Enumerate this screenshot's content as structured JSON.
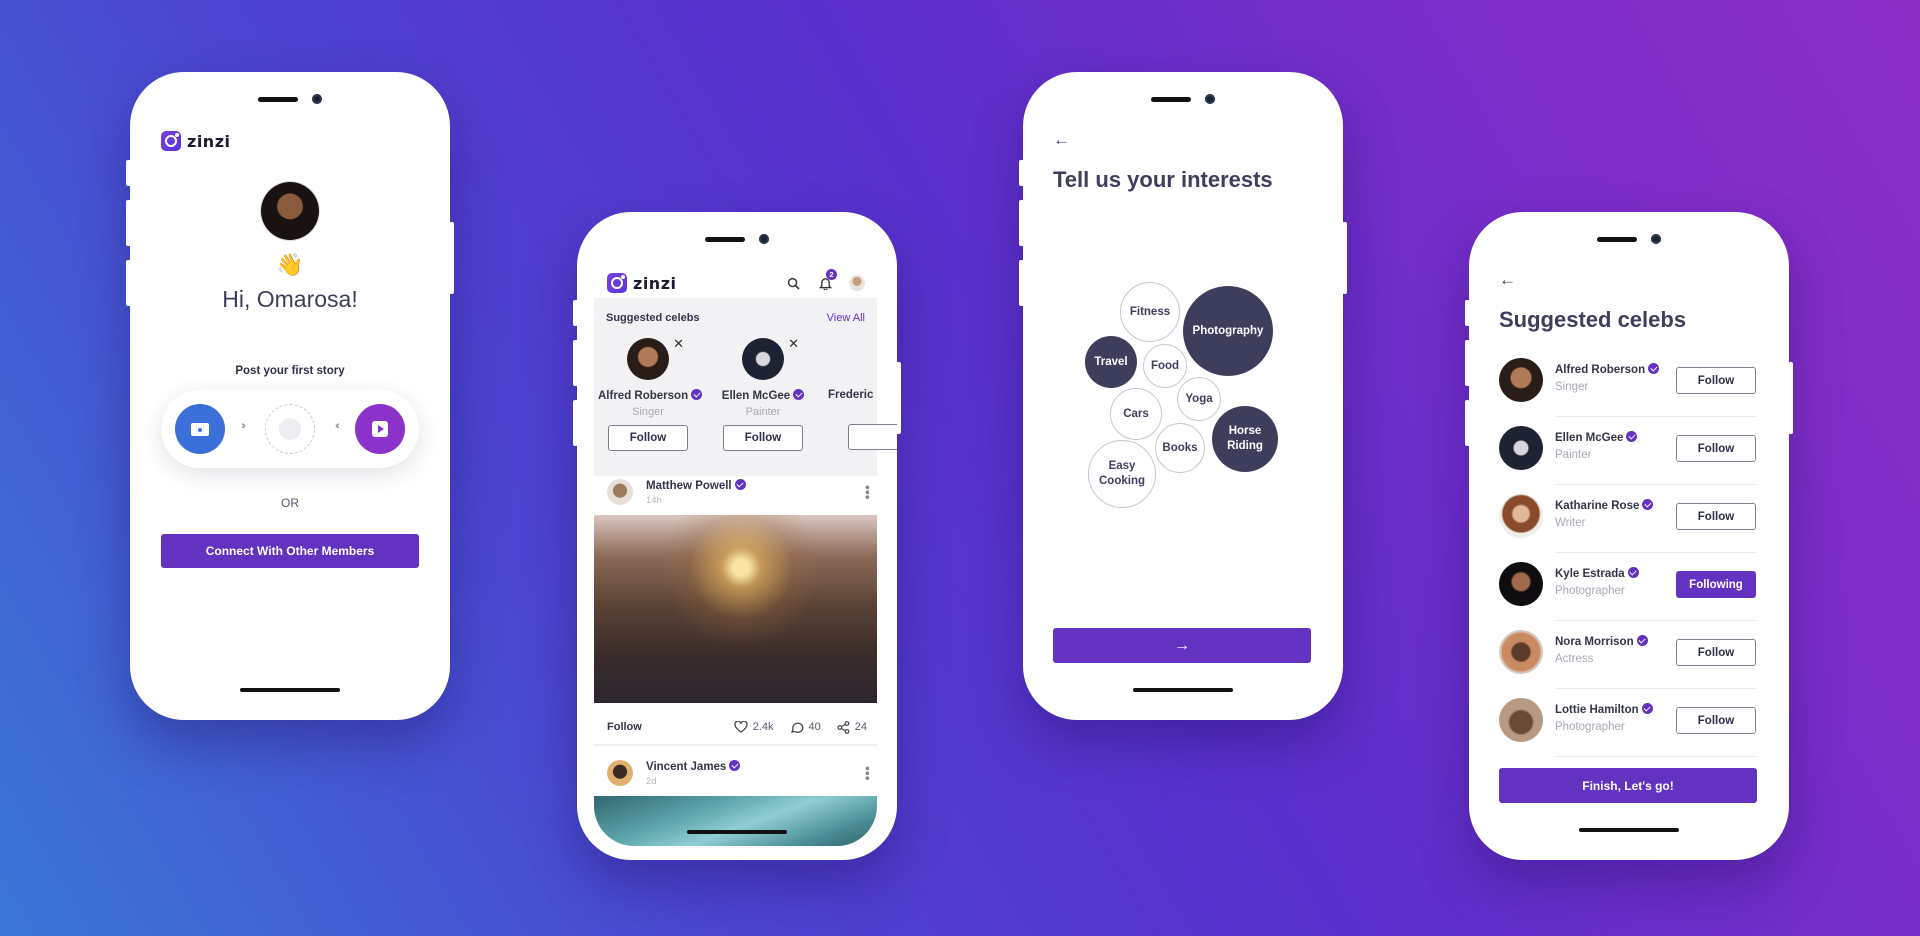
{
  "brand": {
    "name": "zinzi",
    "accent": "#6332c1"
  },
  "background": {
    "gradient": [
      "#3a77d6",
      "#5a30cc",
      "#8a2ec6"
    ]
  },
  "welcome_screen": {
    "emoji": "👋",
    "greeting": "Hi, Omarosa!",
    "story_prompt": "Post your first story",
    "story_actions": [
      {
        "icon": "camera-icon",
        "color": "#3b6fd9"
      },
      {
        "icon": "video-icon",
        "color": "#8a32c9"
      }
    ],
    "or_label": "OR",
    "connect_button": "Connect With Other Members"
  },
  "feed_screen": {
    "notification_count": "2",
    "suggested": {
      "title": "Suggested celebs",
      "view_all": "View All",
      "celebs": [
        {
          "name": "Alfred Roberson",
          "role": "Singer",
          "button": "Follow"
        },
        {
          "name": "Ellen McGee",
          "role": "Painter",
          "button": "Follow"
        },
        {
          "name": "Frederic",
          "role": "",
          "button": ""
        }
      ]
    },
    "posts": [
      {
        "author": "Matthew Powell",
        "time": "14h",
        "follow": "Follow",
        "likes": "2.4k",
        "comments": "40",
        "shares": "24"
      },
      {
        "author": "Vincent James",
        "time": "2d"
      }
    ]
  },
  "interests_screen": {
    "title": "Tell us your interests",
    "interests": [
      {
        "label": "Fitness",
        "selected": false
      },
      {
        "label": "Photography",
        "selected": true
      },
      {
        "label": "Travel",
        "selected": true
      },
      {
        "label": "Food",
        "selected": false
      },
      {
        "label": "Yoga",
        "selected": false
      },
      {
        "label": "Cars",
        "selected": false
      },
      {
        "label": "Books",
        "selected": false
      },
      {
        "label": "Horse Riding",
        "selected": true
      },
      {
        "label": "Easy Cooking",
        "selected": false
      }
    ],
    "next_button": "→"
  },
  "celebs_screen": {
    "title": "Suggested celebs",
    "celebs": [
      {
        "name": "Alfred Roberson",
        "role": "Singer",
        "button": "Follow",
        "following": false
      },
      {
        "name": "Ellen McGee",
        "role": "Painter",
        "button": "Follow",
        "following": false
      },
      {
        "name": "Katharine Rose",
        "role": "Writer",
        "button": "Follow",
        "following": false
      },
      {
        "name": "Kyle Estrada",
        "role": "Photographer",
        "button": "Following",
        "following": true
      },
      {
        "name": "Nora Morrison",
        "role": "Actress",
        "button": "Follow",
        "following": false
      },
      {
        "name": "Lottie Hamilton",
        "role": "Photographer",
        "button": "Follow",
        "following": false
      }
    ],
    "finish_button": "Finish, Let's go!"
  }
}
